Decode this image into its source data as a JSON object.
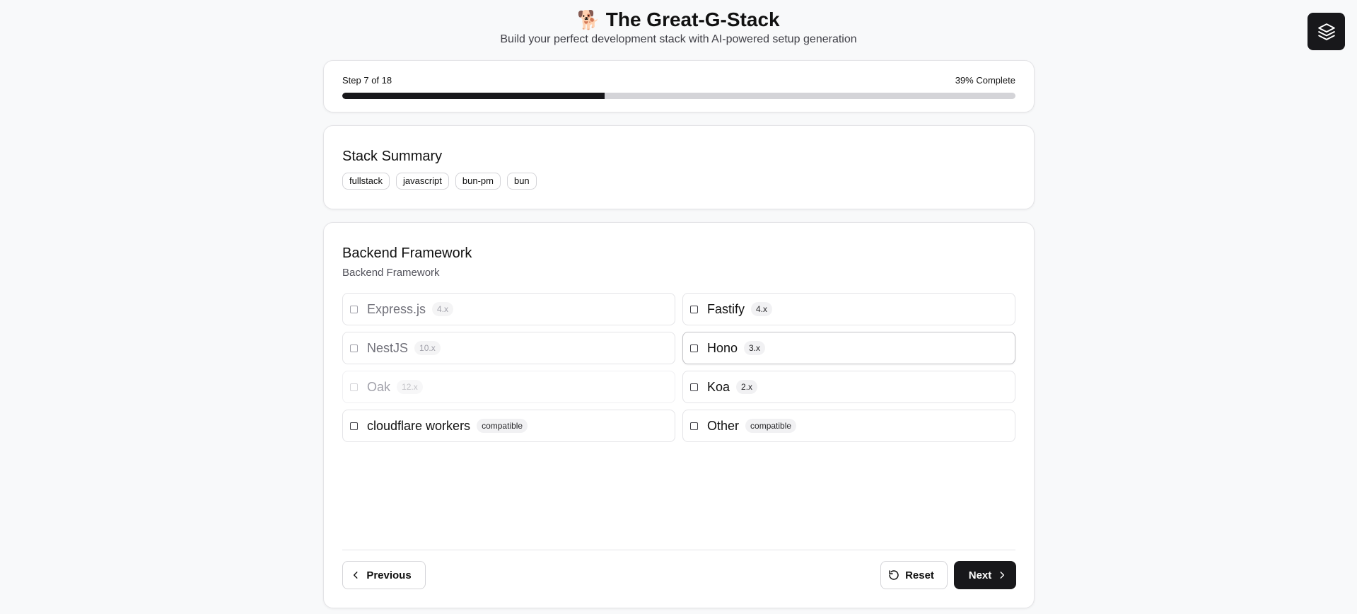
{
  "header": {
    "emoji": "🐕",
    "title": "The Great-G-Stack",
    "subtitle": "Build your perfect development stack with AI-powered setup generation"
  },
  "progress": {
    "step_text": "Step 7 of 18",
    "percent_text": "39% Complete",
    "fraction": 0.39
  },
  "summary": {
    "title": "Stack Summary",
    "chips": [
      "fullstack",
      "javascript",
      "bun-pm",
      "bun"
    ]
  },
  "section": {
    "title": "Backend Framework",
    "subtitle": "Backend Framework",
    "options": [
      {
        "name": "Express.js",
        "badge": "4.x",
        "state": "disabled",
        "checked": false
      },
      {
        "name": "Fastify",
        "badge": "4.x",
        "state": "enabled",
        "checked": false
      },
      {
        "name": "NestJS",
        "badge": "10.x",
        "state": "disabled",
        "checked": false
      },
      {
        "name": "Hono",
        "badge": "3.x",
        "state": "hover",
        "checked": false
      },
      {
        "name": "Oak",
        "badge": "12.x",
        "state": "faint",
        "checked": false
      },
      {
        "name": "Koa",
        "badge": "2.x",
        "state": "enabled",
        "checked": false
      },
      {
        "name": "cloudflare workers",
        "badge": "compatible",
        "state": "enabled",
        "checked": false
      },
      {
        "name": "Other",
        "badge": "compatible",
        "state": "enabled",
        "checked": false
      }
    ]
  },
  "nav": {
    "previous_label": "Previous",
    "reset_label": "Reset",
    "next_label": "Next"
  },
  "colors": {
    "primary": "#18181b",
    "background": "#f8f9fa",
    "track": "#d4d4d8"
  },
  "icons": {
    "top_right": "layers-icon",
    "previous": "chevron-left-icon",
    "reset": "rotate-ccw-icon",
    "next": "chevron-right-icon"
  }
}
